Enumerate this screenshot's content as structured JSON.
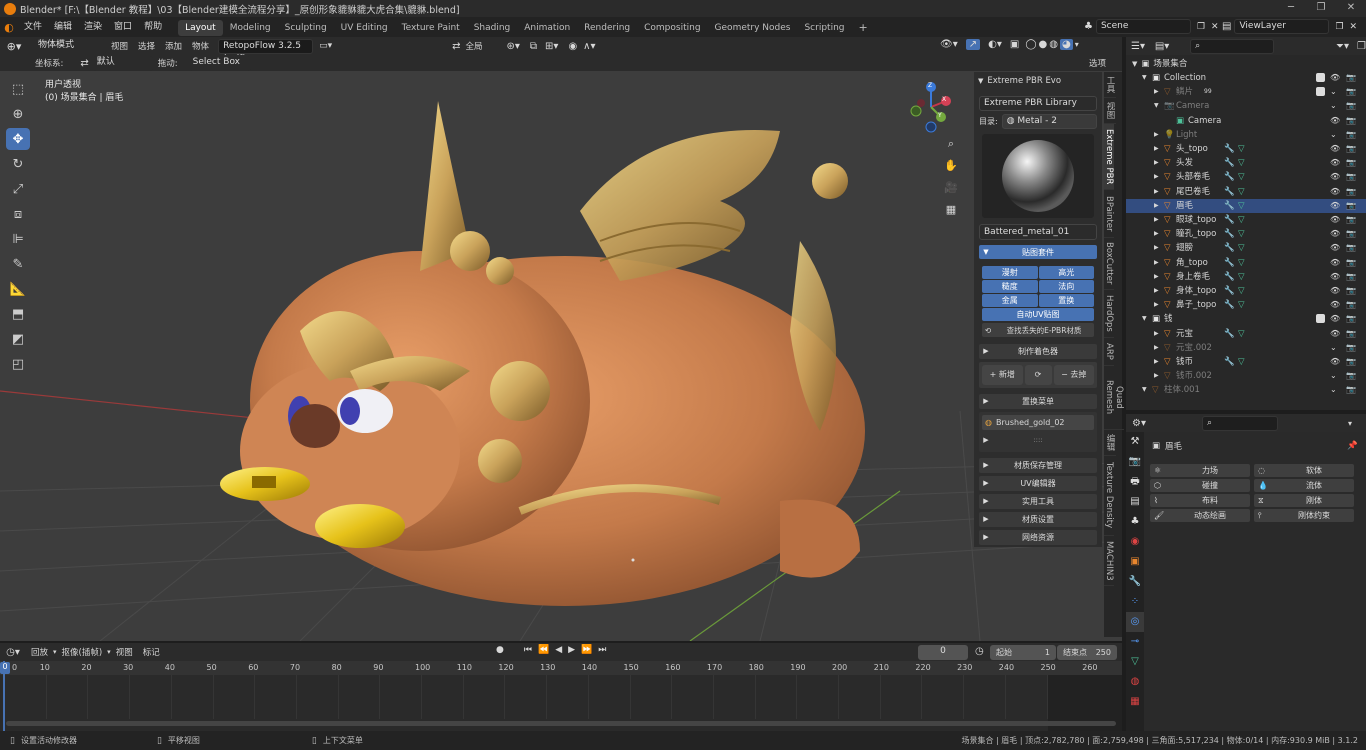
{
  "window": {
    "title": "Blender* [F:\\【Blender 教程】\\03【Blender建模全流程分享】_原创形象貔貅貔大虎合集\\貔貅.blend]"
  },
  "menu": [
    "文件",
    "编辑",
    "渲染",
    "窗口",
    "帮助"
  ],
  "workspaces": [
    "Layout",
    "Modeling",
    "Sculpting",
    "UV Editing",
    "Texture Paint",
    "Shading",
    "Animation",
    "Rendering",
    "Compositing",
    "Geometry Nodes",
    "Scripting"
  ],
  "active_workspace": "Layout",
  "scene": {
    "name": "Scene",
    "view_layer": "ViewLayer"
  },
  "viewport_header": {
    "mode": "物体模式",
    "menus": [
      "视图",
      "选择",
      "添加",
      "物体"
    ],
    "addon": "RetopoFlow 3.2.5 (self)",
    "transform_orientation": "全局",
    "coord_label": "坐标系:",
    "coord_value": "默认",
    "drag_label": "拖动:",
    "drag_value": "Select Box",
    "options": "选项"
  },
  "viewport_overlay": {
    "view_name": "用户透视",
    "collection_info": "(0) 场景集合 | 眉毛"
  },
  "gizmo_axes": {
    "x": "X",
    "y": "Y",
    "z": "Z"
  },
  "npanel": {
    "title": "Extreme PBR Evo",
    "library": "Extreme PBR Library",
    "dir_label": "目录:",
    "dir_value": "Metal - 2",
    "material_name": "Battered_metal_01",
    "section_maps": "贴图套件",
    "map_buttons": [
      "漫射",
      "高光",
      "糙度",
      "法向",
      "金属",
      "置换"
    ],
    "auto_uv": "自动UV贴图",
    "find_missing": "查找丢失的E-PBR材质",
    "make_shader": "制作着色器",
    "add_new": "新增",
    "remove": "去掉",
    "replace_menu": "置换菜单",
    "slot_material": "Brushed_gold_02",
    "more": "::::",
    "panels": [
      "材质保存管理",
      "UV编辑器",
      "实用工具",
      "材质设置",
      "网络资源"
    ]
  },
  "side_tabs": [
    "工具",
    "视图",
    "Extreme PBR",
    "BPainter",
    "BoxCutter",
    "HardOps",
    "ARP",
    "Quad Remesh",
    "编辑",
    "Texture Density",
    "MACHIN3"
  ],
  "outliner": {
    "root": "场景集合",
    "rows": [
      {
        "name": "Collection",
        "icon": "collection-icon",
        "level": 1,
        "dim": false,
        "checkbox": true
      },
      {
        "name": "鳞片",
        "icon": "mesh-icon",
        "level": 2,
        "dim": true,
        "extra": "99",
        "checkbox": true
      },
      {
        "name": "Camera",
        "icon": "camera-icon",
        "level": 2,
        "dim": true
      },
      {
        "name": "Camera",
        "icon": "camera-data-icon",
        "level": 3,
        "dim": false
      },
      {
        "name": "Light",
        "icon": "light-icon",
        "level": 2,
        "dim": true
      },
      {
        "name": "头_topo",
        "icon": "mesh-icon",
        "level": 2,
        "dim": false
      },
      {
        "name": "头发",
        "icon": "mesh-icon",
        "level": 2,
        "dim": false
      },
      {
        "name": "头部卷毛",
        "icon": "mesh-icon",
        "level": 2,
        "dim": false
      },
      {
        "name": "尾巴卷毛",
        "icon": "mesh-icon",
        "level": 2,
        "dim": false
      },
      {
        "name": "眉毛",
        "icon": "mesh-icon",
        "level": 2,
        "dim": false,
        "selected": true
      },
      {
        "name": "眼球_topo",
        "icon": "mesh-icon",
        "level": 2,
        "dim": false
      },
      {
        "name": "瞳孔_topo",
        "icon": "mesh-icon",
        "level": 2,
        "dim": false
      },
      {
        "name": "翅膀",
        "icon": "mesh-icon",
        "level": 2,
        "dim": false
      },
      {
        "name": "角_topo",
        "icon": "mesh-icon",
        "level": 2,
        "dim": false
      },
      {
        "name": "身上卷毛",
        "icon": "mesh-icon",
        "level": 2,
        "dim": false
      },
      {
        "name": "身体_topo",
        "icon": "mesh-icon",
        "level": 2,
        "dim": false
      },
      {
        "name": "鼻子_topo",
        "icon": "mesh-icon",
        "level": 2,
        "dim": false
      },
      {
        "name": "钱",
        "icon": "collection-icon",
        "level": 1,
        "dim": false,
        "checkbox": true
      },
      {
        "name": "元宝",
        "icon": "mesh-icon",
        "level": 2,
        "dim": false
      },
      {
        "name": "元宝.002",
        "icon": "mesh-icon",
        "level": 2,
        "dim": true
      },
      {
        "name": "钱币",
        "icon": "mesh-icon",
        "level": 2,
        "dim": false
      },
      {
        "name": "钱币.002",
        "icon": "mesh-icon",
        "level": 2,
        "dim": true
      },
      {
        "name": "柱体.001",
        "icon": "mesh-icon",
        "level": 1,
        "dim": true
      }
    ]
  },
  "properties": {
    "object_name": "眉毛",
    "physics_buttons": [
      {
        "label": "力场",
        "icon": "force-icon"
      },
      {
        "label": "软体",
        "icon": "softbody-icon"
      },
      {
        "label": "碰撞",
        "icon": "collision-icon"
      },
      {
        "label": "流体",
        "icon": "fluid-icon"
      },
      {
        "label": "布料",
        "icon": "cloth-icon"
      },
      {
        "label": "刚体",
        "icon": "rigidbody-icon"
      },
      {
        "label": "动态绘画",
        "icon": "dynamic-paint-icon"
      },
      {
        "label": "刚体约束",
        "icon": "constraint-icon"
      }
    ]
  },
  "timeline": {
    "menus": [
      "回放",
      "抠像(插帧)",
      "视图",
      "标记"
    ],
    "current_frame": "0",
    "start_label": "起始",
    "start": "1",
    "end_label": "结束点",
    "end": "250",
    "ticks": [
      "0",
      "10",
      "20",
      "30",
      "40",
      "50",
      "60",
      "70",
      "80",
      "90",
      "100",
      "110",
      "120",
      "130",
      "140",
      "150",
      "160",
      "170",
      "180",
      "190",
      "200",
      "210",
      "220",
      "230",
      "240",
      "250",
      "260"
    ]
  },
  "statusbar": {
    "left1": "设置活动修改器",
    "left2": "平移视图",
    "left3": "上下文菜单",
    "right": "场景集合 | 眉毛 | 顶点:2,782,780 | 面:2,759,498 | 三角面:5,517,234 | 物体:0/14 | 内存:930.9 MiB | 3.1.2"
  },
  "colors": {
    "accent": "#4772b3",
    "active_tool": "#4772b3",
    "selected_row": "#334d80",
    "body": "#c47a4a",
    "gold": "#c9a25a"
  }
}
